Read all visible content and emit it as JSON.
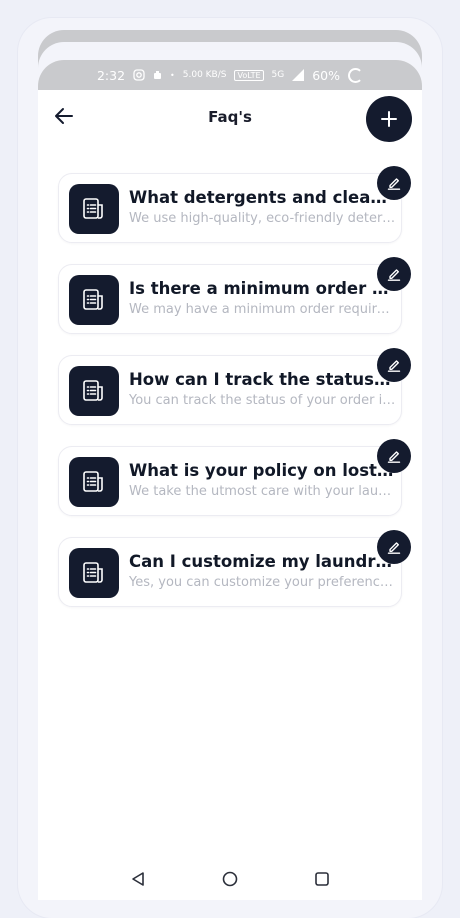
{
  "status_bar": {
    "time": "2:32",
    "net_speed": "5.00 KB/S",
    "network": "VoLTE",
    "signal": "5G",
    "battery": "60%"
  },
  "header": {
    "title": "Faq's",
    "back_icon": "arrow-left-icon",
    "add_icon": "plus-icon"
  },
  "faqs": [
    {
      "question": "What detergents and cleaning products do you use?",
      "answer": "We use high-quality, eco-friendly detergents and cleaning products."
    },
    {
      "question": "Is there a minimum order requirement?",
      "answer": "We may have a minimum order requirement for pickup and delivery."
    },
    {
      "question": "How can I track the status of my order?",
      "answer": "You can track the status of your order in the app."
    },
    {
      "question": "What is your policy on lost or damaged items?",
      "answer": "We take the utmost care with your laundry items."
    },
    {
      "question": "Can I customize my laundry preferences?",
      "answer": "Yes, you can customize your preferences for each order."
    }
  ],
  "icons": {
    "faq_tile": "document-list-icon",
    "edit": "pencil-icon"
  },
  "colors": {
    "accent": "#141b2e",
    "status_bar": "#c9cacd",
    "answer_text": "#b4b7c0"
  }
}
